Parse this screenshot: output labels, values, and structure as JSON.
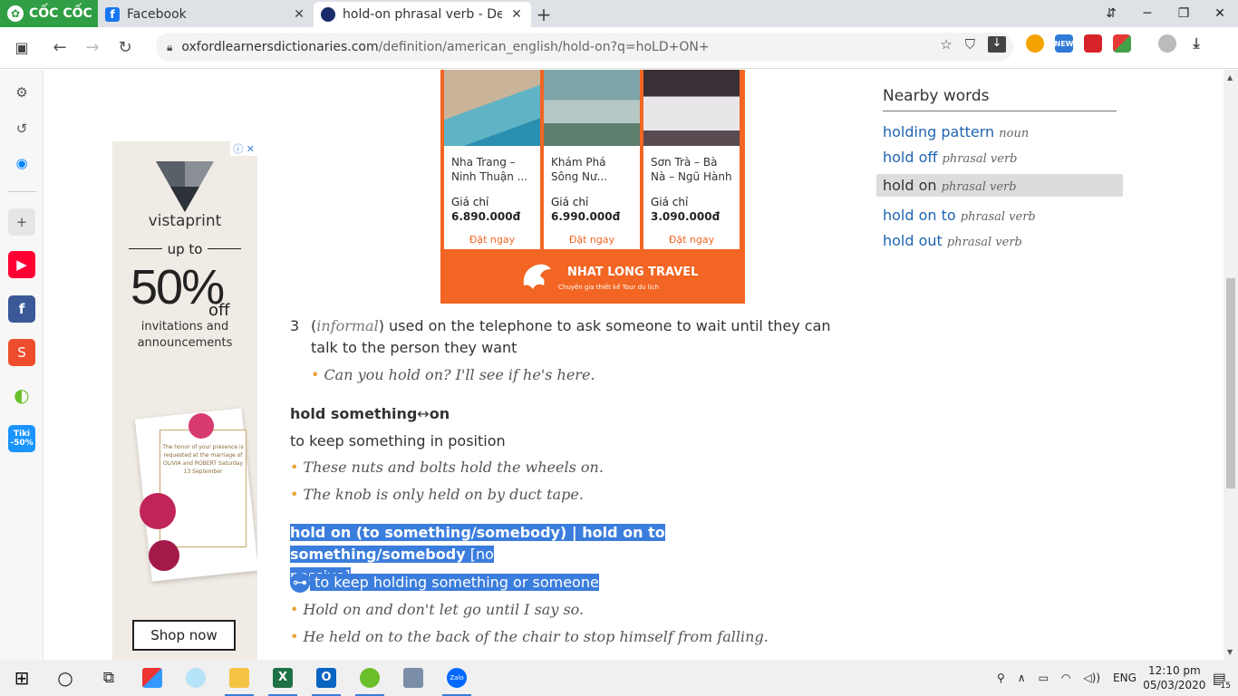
{
  "browser": {
    "brand": "CỐC CỐC",
    "tabs": [
      {
        "title": "Facebook",
        "icon": "facebook-icon",
        "color": "#1877f2"
      },
      {
        "title": "hold-on phrasal verb - Definit",
        "icon": "oxford-icon",
        "color": "#1a2b6b"
      }
    ],
    "url_domain": "oxfordlearnersdictionaries.com",
    "url_path": "/definition/american_english/hold-on?q=hoLD+ON+",
    "extensions": [
      {
        "name": "chrome-ext-icon",
        "color": "#f4a300"
      },
      {
        "name": "new-badge-icon",
        "label": "NEW",
        "color": "#2f7ad8"
      },
      {
        "name": "red-ext-icon",
        "color": "#d8232a"
      },
      {
        "name": "colorful-ext-icon",
        "color": "#7b3fd0"
      }
    ]
  },
  "ad_left": {
    "brand": "vistaprint",
    "upto": "up to",
    "percent": "50%",
    "off": "off",
    "line1": "invitations and",
    "line2": "announcements",
    "card_text": "The honor of your presence is requested at the marriage of OLIVIA and ROBERT Saturday 13 September",
    "cta": "Shop now"
  },
  "ad_top": {
    "products": [
      {
        "title": "Nha Trang – Ninh Thuận ...",
        "price_label": "Giá chỉ",
        "price": "6.890.000đ",
        "cta": "Đặt ngay"
      },
      {
        "title": "Khám Phá Sông Nư...",
        "price_label": "Giá chỉ",
        "price": "6.990.000đ",
        "cta": "Đặt ngay"
      },
      {
        "title": "Sơn Trà – Bà Nà – Ngũ Hành ...",
        "price_label": "Giá chỉ",
        "price": "3.090.000đ",
        "cta": "Đặt ngay"
      }
    ],
    "brand": "NHAT LONG TRAVEL",
    "tagline": "Chuyên gia thiết kế Tour du lịch"
  },
  "entry": {
    "sense3_num": "3",
    "sense3_label": "informal",
    "sense3_def": " used on the telephone to ask someone to wait until they can talk to the person they want",
    "sense3_example": "Can you hold on? I'll see if he's here.",
    "pv1_text": "hold something",
    "pv1_sep": "↔",
    "pv1_end": "on",
    "pv1_def": "to keep something in position",
    "pv1_ex1": "These nuts and bolts hold the wheels on.",
    "pv1_ex2": "The knob is only held on by duct tape.",
    "pv2_line1": "hold on (to something/somebody) | hold on to something/somebody",
    "pv2_label1": "[no",
    "pv2_label2": "passive]",
    "pv2_def": "to keep holding something or someone",
    "pv2_ex1": "Hold on and don't let go until I say so.",
    "pv2_ex2": "He held on to the back of the chair to stop himself from falling."
  },
  "nearby": {
    "heading": "Nearby words",
    "items": [
      {
        "word": "holding pattern",
        "pos": "noun"
      },
      {
        "word": "hold off",
        "pos": "phrasal verb"
      },
      {
        "word": "hold on",
        "pos": "phrasal verb"
      },
      {
        "word": "hold on to",
        "pos": "phrasal verb"
      },
      {
        "word": "hold out",
        "pos": "phrasal verb"
      }
    ]
  },
  "taskbar": {
    "lang": "ENG",
    "time": "12:10 pm",
    "date": "05/03/2020",
    "notifications": "15"
  }
}
